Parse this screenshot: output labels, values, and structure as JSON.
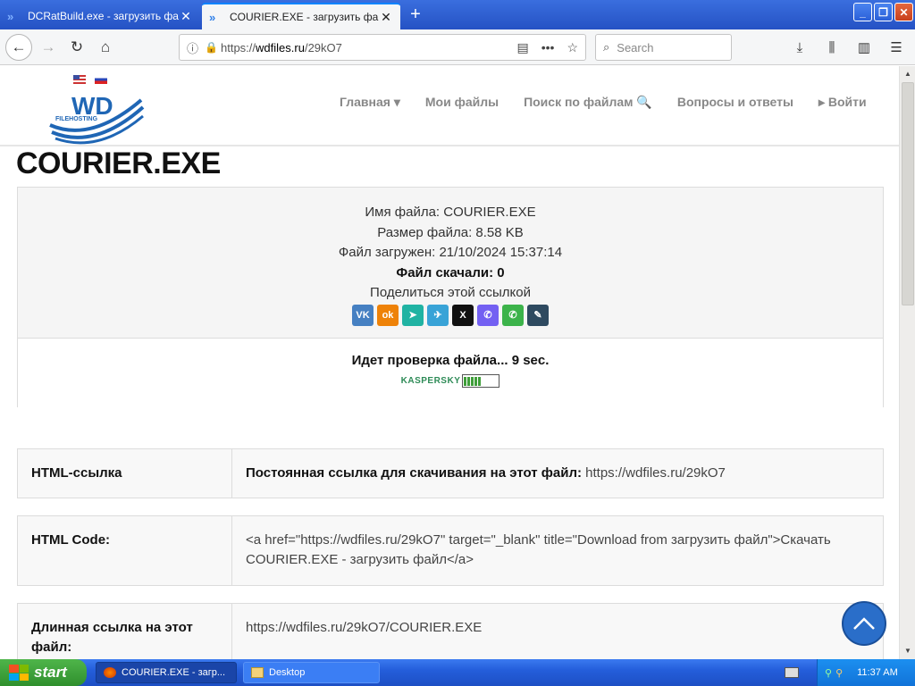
{
  "browser": {
    "tabs": [
      {
        "title": "DCRatBuild.exe - загрузить файл"
      },
      {
        "title": "COURIER.EXE - загрузить файл"
      }
    ],
    "url_prefix": "https://",
    "url_host": "wdfiles.ru",
    "url_path": "/29kO7",
    "search_placeholder": "Search"
  },
  "site": {
    "nav": [
      "Главная ▾",
      "Мои файлы",
      "Поиск по файлам 🔍",
      "Вопросы и ответы",
      "▸ Войти"
    ],
    "logo_text": "WD",
    "logo_sub": "FILEHOSTING"
  },
  "file": {
    "heading": "COURIER.EXE",
    "name_line": "Имя файла: COURIER.EXE",
    "size_line": "Размер файла: 8.58 KB",
    "uploaded_line": "Файл загружен: 21/10/2024 15:37:14",
    "downloads_line": "Файл скачали: 0",
    "share_label": "Поделиться этой ссылкой",
    "share_buttons": [
      {
        "name": "vk-share-button",
        "glyph": "VK",
        "color": "#4680c2"
      },
      {
        "name": "ok-share-button",
        "glyph": "ok",
        "color": "#ee8208"
      },
      {
        "name": "feed-share-button",
        "glyph": "➤",
        "color": "#20b3a3"
      },
      {
        "name": "telegram-share-button",
        "glyph": "✈",
        "color": "#38a3d7"
      },
      {
        "name": "x-share-button",
        "glyph": "X",
        "color": "#111111"
      },
      {
        "name": "viber-share-button",
        "glyph": "✆",
        "color": "#7360f2"
      },
      {
        "name": "whatsapp-share-button",
        "glyph": "✆",
        "color": "#3cb34a"
      },
      {
        "name": "livejournal-share-button",
        "glyph": "✎",
        "color": "#2e4a60"
      }
    ],
    "check_status": "Идет проверка файла... 9 sec.",
    "antivirus_name": "KASPERSKY"
  },
  "links": {
    "html_link_label": "HTML-ссылка",
    "html_link_bold": "Постоянная ссылка для скачивания на этот файл:",
    "html_link_url": "https://wdfiles.ru/29kO7",
    "html_code_label": "HTML Code:",
    "html_code_value": "<a href=\"https://wdfiles.ru/29kO7\" target=\"_blank\" title=\"Download from загрузить файл\">Скачать COURIER.EXE - загрузить файл</a>",
    "long_link_label": "Длинная ссылка на этот файл:",
    "long_link_value": "https://wdfiles.ru/29kO7/COURIER.EXE"
  },
  "taskbar": {
    "start_label": "start",
    "tasks": [
      "COURIER.EXE - загр...",
      "Desktop"
    ],
    "clock": "11:37 AM"
  }
}
